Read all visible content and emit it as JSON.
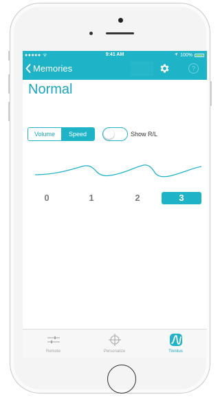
{
  "status_bar": {
    "carrier": "●●●●● ᯤ",
    "time": "9:41 AM",
    "battery_text": "100%",
    "location_icon": "location-arrow-icon"
  },
  "nav": {
    "back_label": "Memories",
    "back_icon": "chevron-left-icon",
    "settings_icon": "gear-icon",
    "help_label": "?"
  },
  "page": {
    "title": "Normal"
  },
  "mode_segment": {
    "options": [
      "Volume",
      "Speed"
    ],
    "selected": "Speed"
  },
  "show_rl": {
    "label": "Show R/L",
    "on": false
  },
  "speed_selector": {
    "options": [
      "0",
      "1",
      "2",
      "3"
    ],
    "selected": "3"
  },
  "tab_bar": {
    "tabs": [
      {
        "label": "Remote",
        "icon": "sliders-icon"
      },
      {
        "label": "Personalize",
        "icon": "crosshair-icon"
      },
      {
        "label": "Tinnitus",
        "icon": "tinnitus-wave-icon"
      }
    ],
    "active": "Tinnitus"
  },
  "colors": {
    "accent": "#1fb3c7",
    "title": "#1aa6bb",
    "muted": "#a4a4a4"
  }
}
